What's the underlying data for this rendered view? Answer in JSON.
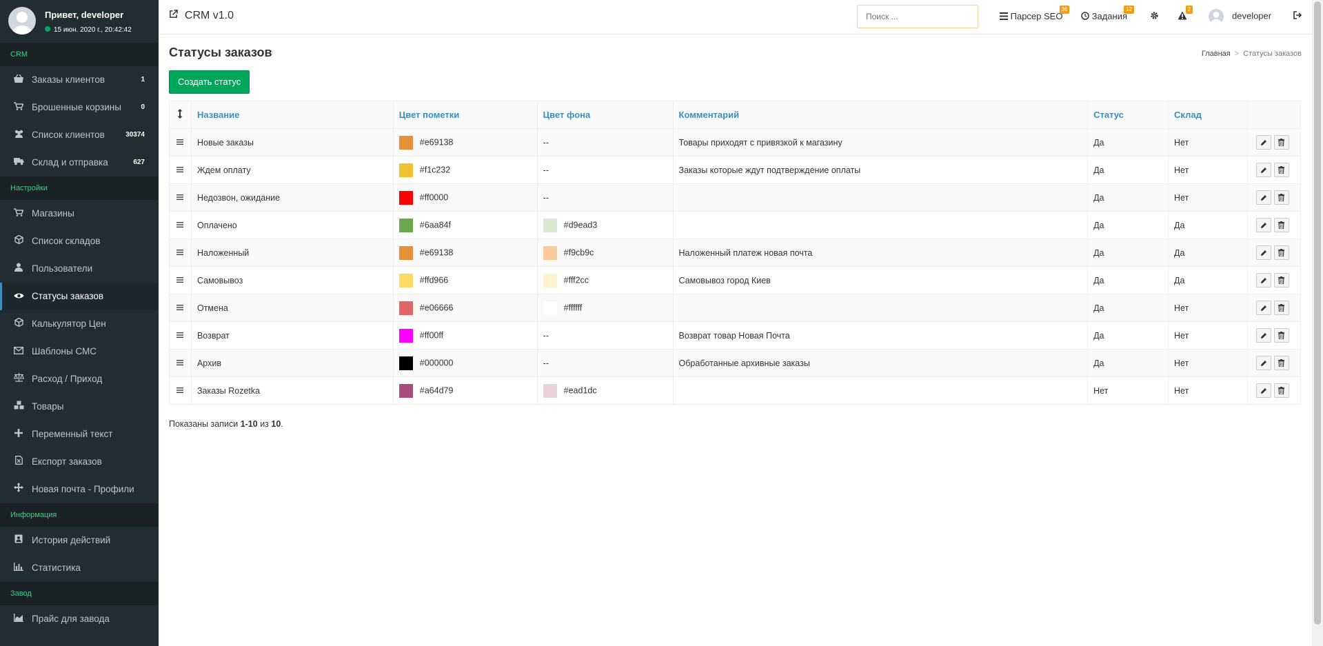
{
  "user": {
    "greeting": "Привет, developer",
    "datetime": "15 июн. 2020 г., 20:42:42"
  },
  "sidebar": {
    "sections": [
      {
        "title": "CRM",
        "items": [
          {
            "label": "Заказы клиентов",
            "icon": "basket-icon",
            "count": "1"
          },
          {
            "label": "Брошенные корзины",
            "icon": "cart-icon",
            "count": "0"
          },
          {
            "label": "Список клиентов",
            "icon": "users-icon",
            "count": "30374"
          },
          {
            "label": "Склад и отправка",
            "icon": "truck-icon",
            "count": "627"
          }
        ]
      },
      {
        "title": "Настройки",
        "items": [
          {
            "label": "Магазины",
            "icon": "cart-icon"
          },
          {
            "label": "Список складов",
            "icon": "cube-icon"
          },
          {
            "label": "Пользователи",
            "icon": "user-icon"
          },
          {
            "label": "Статусы заказов",
            "icon": "eye-icon",
            "active": true
          },
          {
            "label": "Калькулятор Цен",
            "icon": "cube-icon"
          },
          {
            "label": "Шаблоны СМС",
            "icon": "envelope-icon"
          },
          {
            "label": "Расход / Приход",
            "icon": "balance-icon"
          },
          {
            "label": "Товары",
            "icon": "cubes-icon"
          },
          {
            "label": "Переменный текст",
            "icon": "plus-icon"
          },
          {
            "label": "Експорт заказов",
            "icon": "excel-icon"
          },
          {
            "label": "Новая почта - Профили",
            "icon": "arrows-icon"
          }
        ]
      },
      {
        "title": "Информация",
        "items": [
          {
            "label": "История действий",
            "icon": "address-book-icon"
          },
          {
            "label": "Статистика",
            "icon": "bar-chart-icon"
          }
        ]
      },
      {
        "title": "Завод",
        "items": [
          {
            "label": "Прайс для завода",
            "icon": "area-chart-icon"
          }
        ]
      }
    ]
  },
  "topbar": {
    "brand": "CRM v1.0",
    "search_placeholder": "Поиск ...",
    "seo_label": "Парсер SEO",
    "seo_badge": "36",
    "tasks_label": "Задания",
    "tasks_badge": "12",
    "alerts_badge": "2",
    "username": "developer"
  },
  "page": {
    "title": "Статусы заказов",
    "breadcrumb_home": "Главная",
    "breadcrumb_current": "Статусы заказов",
    "create_button": "Создать статус",
    "summary_prefix": "Показаны записи ",
    "summary_range": "1-10",
    "summary_mid": " из ",
    "summary_total": "10",
    "summary_suffix": "."
  },
  "table": {
    "headers": {
      "name": "Название",
      "mark_color": "Цвет пометки",
      "bg_color": "Цвет фона",
      "comment": "Комментарий",
      "status": "Статус",
      "warehouse": "Склад"
    },
    "rows": [
      {
        "name": "Новые заказы",
        "mark": "#e69138",
        "bg": "--",
        "comment": "Товары приходят с привязкой к магазину",
        "status": "Да",
        "warehouse": "Нет"
      },
      {
        "name": "Ждем оплату",
        "mark": "#f1c232",
        "bg": "--",
        "comment": "Заказы которые ждут подтверждение оплаты",
        "status": "Да",
        "warehouse": "Нет"
      },
      {
        "name": "Недозвон, ожидание",
        "mark": "#ff0000",
        "bg": "--",
        "comment": "",
        "status": "Да",
        "warehouse": "Нет"
      },
      {
        "name": "Оплачено",
        "mark": "#6aa84f",
        "bg": "#d9ead3",
        "comment": "",
        "status": "Да",
        "warehouse": "Да"
      },
      {
        "name": "Наложенный",
        "mark": "#e69138",
        "bg": "#f9cb9c",
        "comment": "Наложенный платеж новая почта",
        "status": "Да",
        "warehouse": "Да"
      },
      {
        "name": "Самовывоз",
        "mark": "#ffd966",
        "bg": "#fff2cc",
        "comment": "Самовывоз город Киев",
        "status": "Да",
        "warehouse": "Да"
      },
      {
        "name": "Отмена",
        "mark": "#e06666",
        "bg": "#ffffff",
        "comment": "",
        "status": "Да",
        "warehouse": "Нет"
      },
      {
        "name": "Возврат",
        "mark": "#ff00ff",
        "bg": "--",
        "comment": "Возврат товар Новая Почта",
        "status": "Да",
        "warehouse": "Нет"
      },
      {
        "name": "Архив",
        "mark": "#000000",
        "bg": "--",
        "comment": "Обработанные архивные заказы",
        "status": "Да",
        "warehouse": "Нет"
      },
      {
        "name": "Заказы Rozetka",
        "mark": "#a64d79",
        "bg": "#ead1dc",
        "comment": "",
        "status": "Нет",
        "warehouse": "Нет"
      }
    ]
  }
}
